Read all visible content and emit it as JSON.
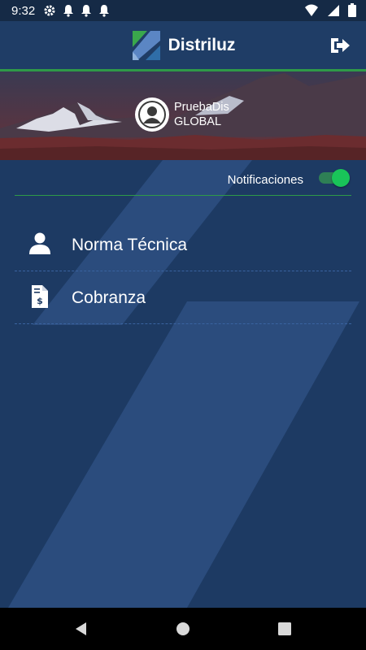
{
  "status_bar": {
    "time": "9:32"
  },
  "app_bar": {
    "brand": "Distriluz"
  },
  "profile": {
    "name": "PruebaDis",
    "role": "GLOBAL"
  },
  "notifications": {
    "label": "Notificaciones",
    "enabled": true
  },
  "menu": [
    {
      "label": "Norma Técnica",
      "icon": "user-icon"
    },
    {
      "label": "Cobranza",
      "icon": "invoice-icon"
    }
  ],
  "colors": {
    "primary": "#1d3a63",
    "accent": "#2f9a48",
    "toggle": "#19c459"
  }
}
